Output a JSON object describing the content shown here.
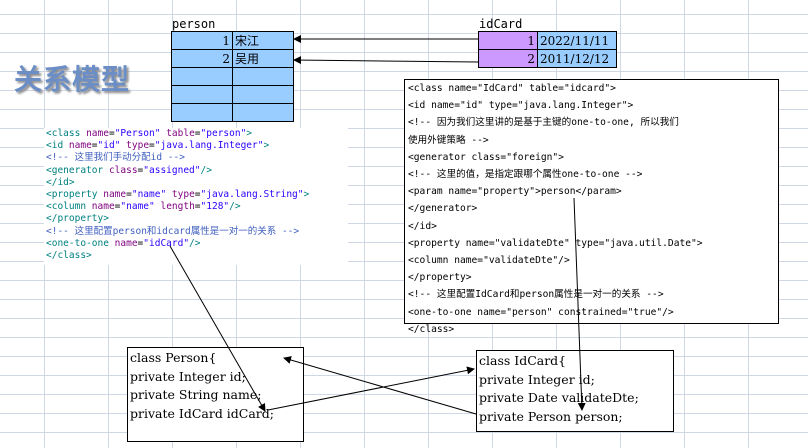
{
  "page_title": "关系模型",
  "person_table": {
    "name": "person",
    "rows": [
      {
        "id": "1",
        "name": "宋江"
      },
      {
        "id": "2",
        "name": "吴用"
      },
      {
        "id": "",
        "name": ""
      },
      {
        "id": "",
        "name": ""
      },
      {
        "id": "",
        "name": ""
      }
    ]
  },
  "idcard_table": {
    "name": "idCard",
    "rows": [
      {
        "id": "1",
        "date": "2022/11/11"
      },
      {
        "id": "2",
        "date": "2011/12/12"
      }
    ]
  },
  "person_mapping": {
    "lines": [
      "<class name=\"Person\" table=\"person\">",
      "<id name=\"id\" type=\"java.lang.Integer\">",
      "<!-- 这里我们手动分配id -->",
      "<generator class=\"assigned\"/>",
      "</id>",
      "<property name=\"name\" type=\"java.lang.String\">",
      "<column name=\"name\" length=\"128\"/>",
      "</property>",
      "<!-- 这里配置person和idcard属性是一对一的关系 -->",
      "<one-to-one name=\"idCard\"/>",
      "</class>"
    ]
  },
  "idcard_mapping": {
    "lines": [
      "<class name=\"IdCard\" table=\"idcard\">",
      "<id name=\"id\" type=\"java.lang.Integer\">",
      "<!-- 因为我们这里讲的是基于主键的one-to-one, 所以我们",
      "使用外键策略 -->",
      "<generator class=\"foreign\">",
      "<!-- 这里的值，是指定跟哪个属性one-to-one -->",
      "<param name=\"property\">person</param>",
      "</generator>",
      "</id>",
      "<property name=\"validateDte\" type=\"java.util.Date\">",
      "<column name=\"validateDte\"/>",
      "</property>",
      "<!-- 这里配置IdCard和person属性是一对一的关系 -->",
      "<one-to-one name=\"person\" constrained=\"true\"/>",
      "</class>"
    ]
  },
  "person_class": {
    "lines": [
      "class Person{",
      "private Integer id;",
      "private String name;",
      "private IdCard idCard;"
    ]
  },
  "idcard_class": {
    "lines": [
      "class IdCard{",
      "private Integer id;",
      "private Date validateDte;",
      "private Person person;"
    ]
  },
  "colors": {
    "person_cell": "#99ccff",
    "idcard_id_cell": "#cc99ff",
    "title": "#6b8ec7",
    "xml_tag": "#008080",
    "xml_attr": "#7f007f",
    "xml_value": "#2a00ff",
    "xml_comment": "#3f5fbf"
  }
}
